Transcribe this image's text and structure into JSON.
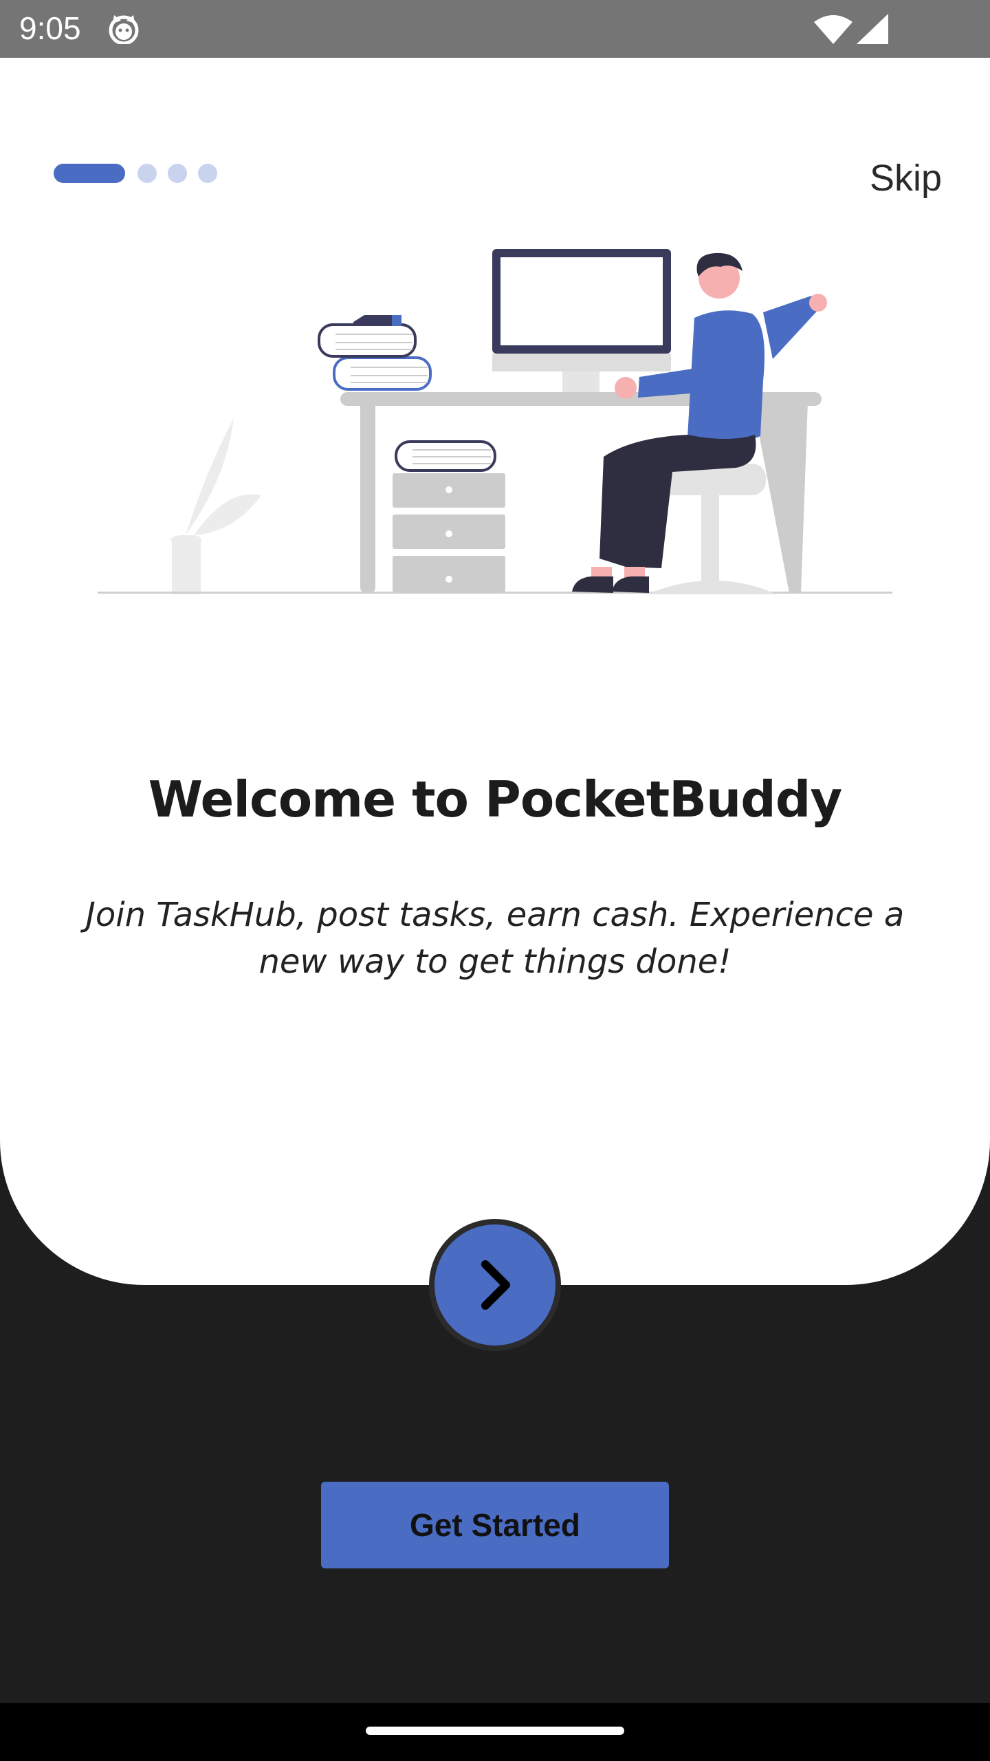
{
  "status_bar": {
    "time": "9:05",
    "icons": [
      "cat-icon",
      "wifi-icon",
      "signal-icon"
    ]
  },
  "onboarding": {
    "pager": {
      "total_pages": 4,
      "current_page": 1
    },
    "skip_label": "Skip",
    "title": "Welcome to PocketBuddy",
    "description": "Join TaskHub, post tasks, earn cash. Experience a new way to get things done!",
    "next_icon": "chevron-right-icon",
    "get_started_label": "Get Started"
  },
  "colors": {
    "accent": "#4a6cc3",
    "accent_light": "#c9d3ee",
    "background_dark": "#1e1e1e",
    "card": "#ffffff",
    "status_bar": "#757575"
  }
}
